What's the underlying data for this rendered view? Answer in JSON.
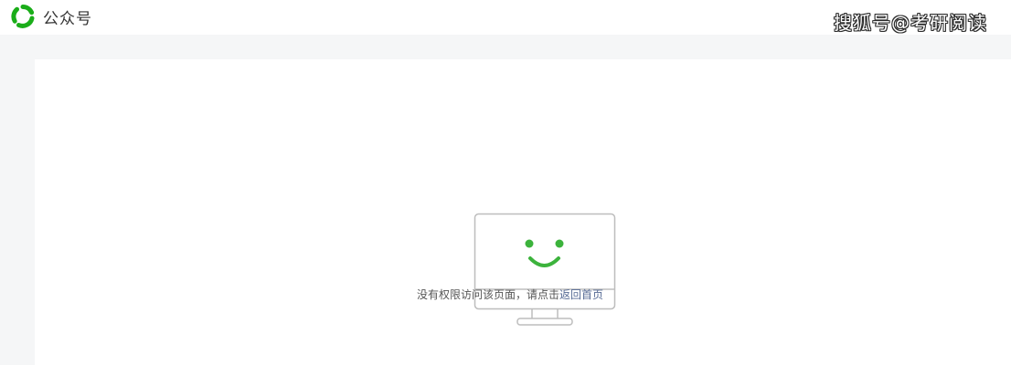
{
  "header": {
    "logo_icon": "wechat-official-account-logo-icon",
    "title": "公众号",
    "brand_color": "#1aad19"
  },
  "watermark": {
    "text": "搜狐号@考研阅读"
  },
  "main": {
    "illustration_icon": "smiling-monitor-icon",
    "smile_color": "#3cb33c",
    "message": {
      "prefix": "没有权限访问该页面，请点击",
      "link": "返回首页",
      "link_color": "#576b95"
    }
  }
}
